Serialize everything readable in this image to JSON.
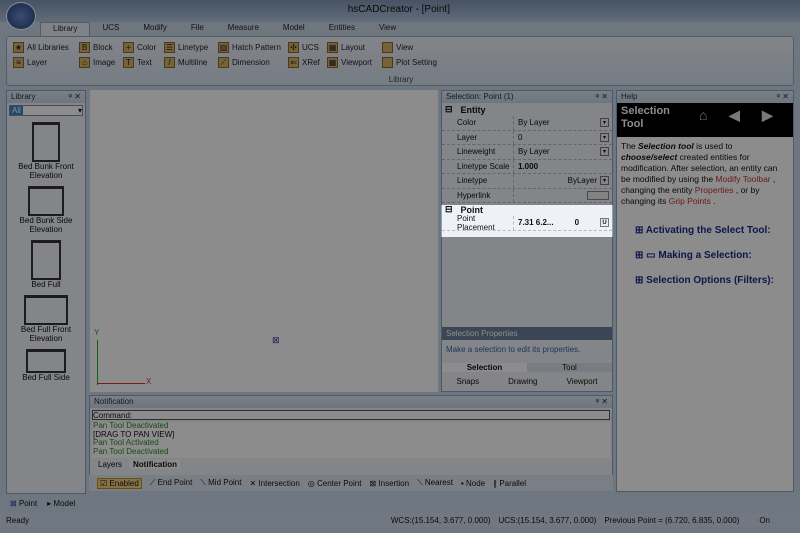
{
  "window": {
    "title": "hsCADCreator - [Point]"
  },
  "ribbon": {
    "tabs": [
      "Library",
      "UCS",
      "Modify",
      "File",
      "Measure",
      "Model",
      "Entities",
      "View"
    ],
    "buttons": [
      "All Libraries",
      "Layer",
      "Block",
      "Image",
      "Color",
      "Text",
      "Linetype",
      "Multiline",
      "Hatch Pattern",
      "Dimension",
      "UCS",
      "XRef",
      "Layout",
      "Viewport",
      "View",
      "Plot Setting"
    ],
    "group_label": "Library"
  },
  "library": {
    "title": "Library",
    "filter": "All",
    "items": [
      "Bed Bunk Front Elevation",
      "Bed Bunk Side Elevation",
      "Bed Full",
      "Bed Full Front Elevation",
      "Bed Full Side"
    ]
  },
  "canvas": {
    "axis_x": "X",
    "axis_y": "Y"
  },
  "selection": {
    "title": "Selection: Point (1)",
    "entity_label": "Entity",
    "rows": [
      {
        "k": "Color",
        "v": "By Layer"
      },
      {
        "k": "Layer",
        "v": "0"
      },
      {
        "k": "Lineweight",
        "v": "By Layer"
      },
      {
        "k": "Linetype Scale",
        "v": "1.000"
      },
      {
        "k": "Linetype",
        "v": "ByLayer"
      },
      {
        "k": "Hyperlink",
        "v": ""
      }
    ],
    "point_label": "Point",
    "point_key": "Point Placement",
    "point_value": "7.31 6.2...",
    "point_z": "0",
    "point_btn": "U",
    "props_title": "Selection Properties",
    "props_hint": "Make a selection to edit its properties.",
    "tabs": [
      "Selection",
      "Tool"
    ],
    "subtabs": [
      "Snaps",
      "Drawing",
      "Viewport"
    ]
  },
  "help": {
    "title": "Help",
    "heading": "Selection Tool",
    "p1": "The ",
    "p1b": "Selection tool",
    "p2": " is used to ",
    "p2b": "choose/select",
    "p3": " created entities for modification. After selection, an entity can be modified by using the ",
    "l1": "Modify Toolbar",
    "p4": " , changing the entity ",
    "l2": "Properties",
    "p5": " , or by changing its ",
    "l3": "Grip Points",
    "p6": " .",
    "links": [
      "Activating the Select Tool:",
      "Making a Selection:",
      "Selection Options (Filters):"
    ]
  },
  "notification": {
    "title": "Notification",
    "command_label": "Command:",
    "log": [
      {
        "t": "Pan Tool Deactivated",
        "c": "g"
      },
      {
        "t": "[DRAG TO PAN VIEW]",
        "c": ""
      },
      {
        "t": "Pan Tool Activated",
        "c": "g"
      },
      {
        "t": "Pan Tool Deactivated",
        "c": "g"
      }
    ],
    "tabs": [
      "Layers",
      "Notification"
    ]
  },
  "snaps": [
    "Enabled",
    "End Point",
    "Mid Point",
    "Intersection",
    "Center Point",
    "Insertion",
    "Nearest",
    "Node",
    "Parallel"
  ],
  "bottom_tabs": [
    "Point",
    "Model"
  ],
  "status": {
    "ready": "Ready",
    "wcs": "WCS:(15.154, 3.677, 0.000)",
    "ucs": "UCS:(15.154, 3.677, 0.000)",
    "prev": "Previous Point = (6.720, 6.835, 0.000)",
    "mode": "On"
  }
}
